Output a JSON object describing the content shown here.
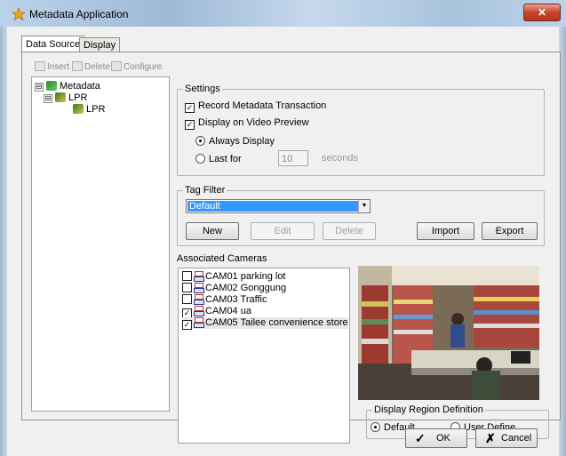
{
  "window": {
    "title": "Metadata Application",
    "close_glyph": "✕"
  },
  "colors": {
    "selection": "#3399ff",
    "titlebar": "#bcd2ea"
  },
  "tabs": [
    {
      "label": "Data Source",
      "active": true
    },
    {
      "label": "Display",
      "active": false
    }
  ],
  "toolbar": {
    "insert": "Insert",
    "delete": "Delete",
    "configure": "Configure"
  },
  "tree": {
    "root": "Metadata",
    "child": "LPR",
    "leaf": "LPR",
    "root_expander": "⊟",
    "child_expander": "⊟"
  },
  "settings": {
    "legend": "Settings",
    "record": {
      "label": "Record Metadata Transaction",
      "checked": true,
      "mark": "✓"
    },
    "display_preview": {
      "label": "Display on Video Preview",
      "checked": true,
      "mark": "✓"
    },
    "always": {
      "label": "Always Display",
      "selected": true
    },
    "last_for": {
      "label": "Last for",
      "value": "10",
      "unit": "seconds",
      "selected": false
    }
  },
  "tag_filter": {
    "legend": "Tag Filter",
    "selected": "Default",
    "arrow": "▼",
    "buttons": {
      "new": "New",
      "edit": "Edit",
      "delete": "Delete",
      "import": "Import",
      "export": "Export"
    }
  },
  "cameras": {
    "heading": "Associated Cameras",
    "items": [
      {
        "label": "CAM01 parking lot",
        "checked": false
      },
      {
        "label": "CAM02 Gonggung",
        "checked": false
      },
      {
        "label": "CAM03 Traffic",
        "checked": false
      },
      {
        "label": "CAM04 ua",
        "checked": true
      },
      {
        "label": "CAM05 Tailee convenience store",
        "checked": true
      }
    ],
    "check_mark": "✓"
  },
  "region": {
    "legend": "Display Region Definition",
    "default": {
      "label": "Default",
      "selected": true
    },
    "user": {
      "label": "User Define",
      "selected": false
    }
  },
  "dialog": {
    "ok": "OK",
    "cancel": "Cancel",
    "ok_glyph": "✓",
    "cancel_glyph": "✗"
  }
}
